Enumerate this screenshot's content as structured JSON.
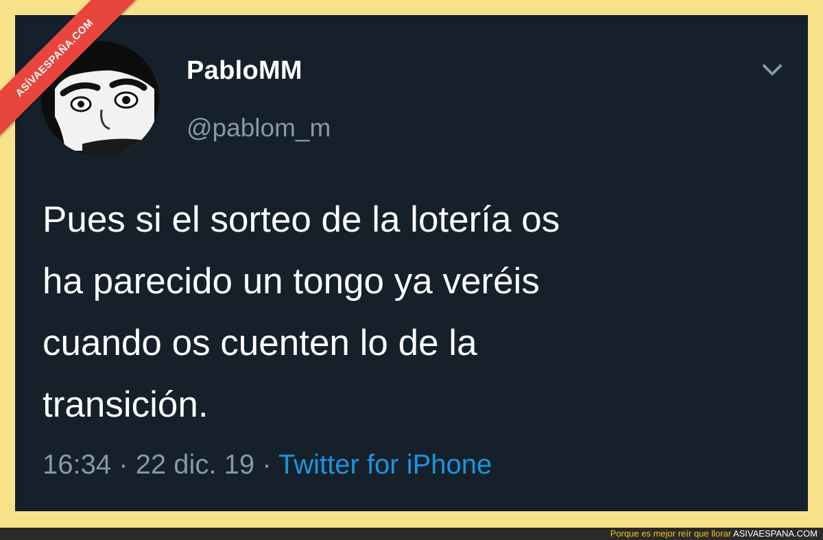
{
  "tweet": {
    "display_name": "PabloMM",
    "handle": "@pablom_m",
    "text_lines": [
      "Pues si el sorteo de la lotería os",
      "ha parecido un tongo ya veréis",
      "cuando os cuenten lo de la",
      "transición."
    ],
    "time": "16:34",
    "date": "22 dic. 19",
    "separator": "·",
    "source": "Twitter for iPhone",
    "menu_icon": "chevron-down-icon"
  },
  "watermark": {
    "ribbon_text": "ASÍVAESPAÑA.COM"
  },
  "footer": {
    "slogan": "Porque es mejor reír que llorar",
    "site": "ASIVAESPANA.COM"
  },
  "colors": {
    "background": "#15202b",
    "frame": "#f7e28a",
    "name": "#ffffff",
    "secondary_text": "#8899a6",
    "link": "#1b95e0",
    "ribbon": "#e8453c"
  }
}
